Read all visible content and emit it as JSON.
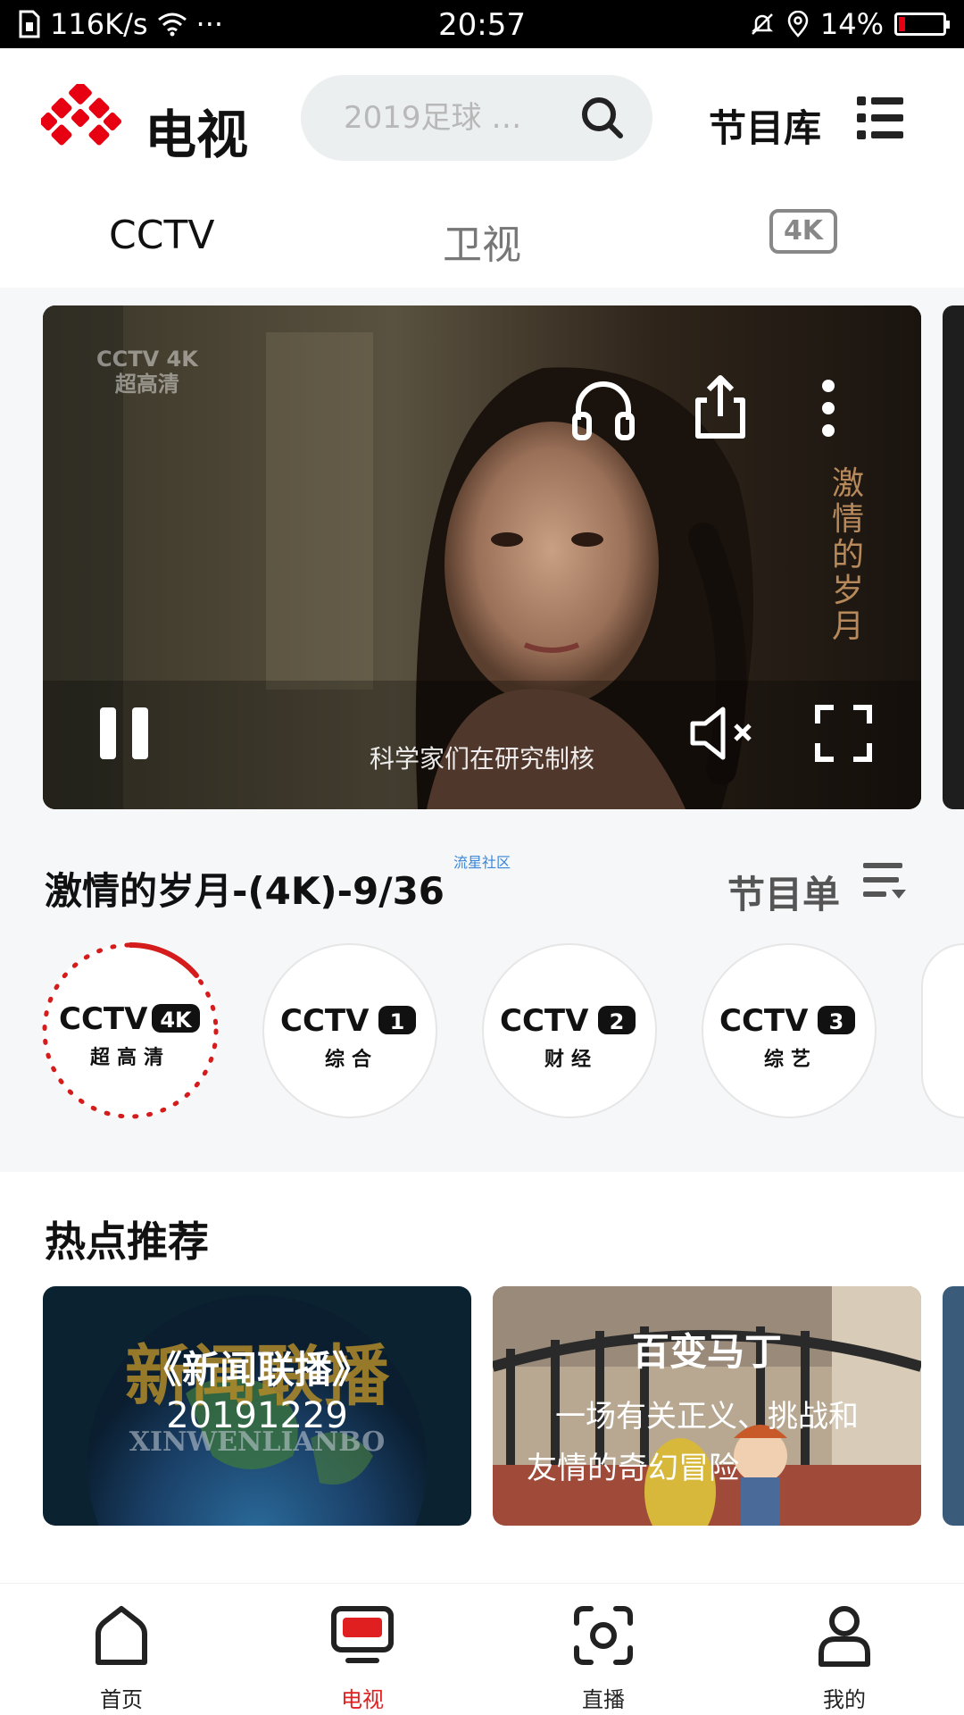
{
  "status_bar": {
    "net_speed": "116K/s",
    "dots": "···",
    "time": "20:57",
    "battery": "14%",
    "battery_level": 0.14
  },
  "header": {
    "logo_text": "电视",
    "search_placeholder": "2019足球 …",
    "library_label": "节目库"
  },
  "tabs": [
    {
      "label": "CCTV",
      "active": true
    },
    {
      "label": "卫视",
      "active": false
    },
    {
      "label": "4K",
      "active": false
    }
  ],
  "player": {
    "watermark_top": "CCTV 4K",
    "watermark_bottom": "超高清",
    "title_watermark": "激情的岁月",
    "subtitle": "科学家们在研究制核"
  },
  "program": {
    "title": "激情的岁月-(4K)-9/36",
    "community_tag": "流星社区",
    "schedule_label": "节目单"
  },
  "channels": [
    {
      "badge": "4K",
      "sub": "超高清",
      "selected": true
    },
    {
      "badge": "1",
      "sub": "综合",
      "selected": false
    },
    {
      "badge": "2",
      "sub": "财经",
      "selected": false
    },
    {
      "badge": "3",
      "sub": "综艺",
      "selected": false
    }
  ],
  "hot": {
    "title": "热点推荐",
    "cards": [
      {
        "bg_text": "新闻联播",
        "bg_sub": "XINWENLIANBO",
        "title": "《新闻联播》",
        "subtitle": "20191229"
      },
      {
        "title": "百变马丁",
        "subtitle_line1": "一场有关正义、挑战和",
        "subtitle_line2": "友情的奇幻冒险"
      }
    ]
  },
  "bottom_nav": [
    {
      "label": "首页",
      "icon": "home-icon",
      "active": false
    },
    {
      "label": "电视",
      "icon": "tv-icon",
      "active": true
    },
    {
      "label": "直播",
      "icon": "live-icon",
      "active": false
    },
    {
      "label": "我的",
      "icon": "profile-icon",
      "active": false
    }
  ],
  "colors": {
    "brand_red": "#e02020",
    "search_bg": "#eceff0"
  }
}
